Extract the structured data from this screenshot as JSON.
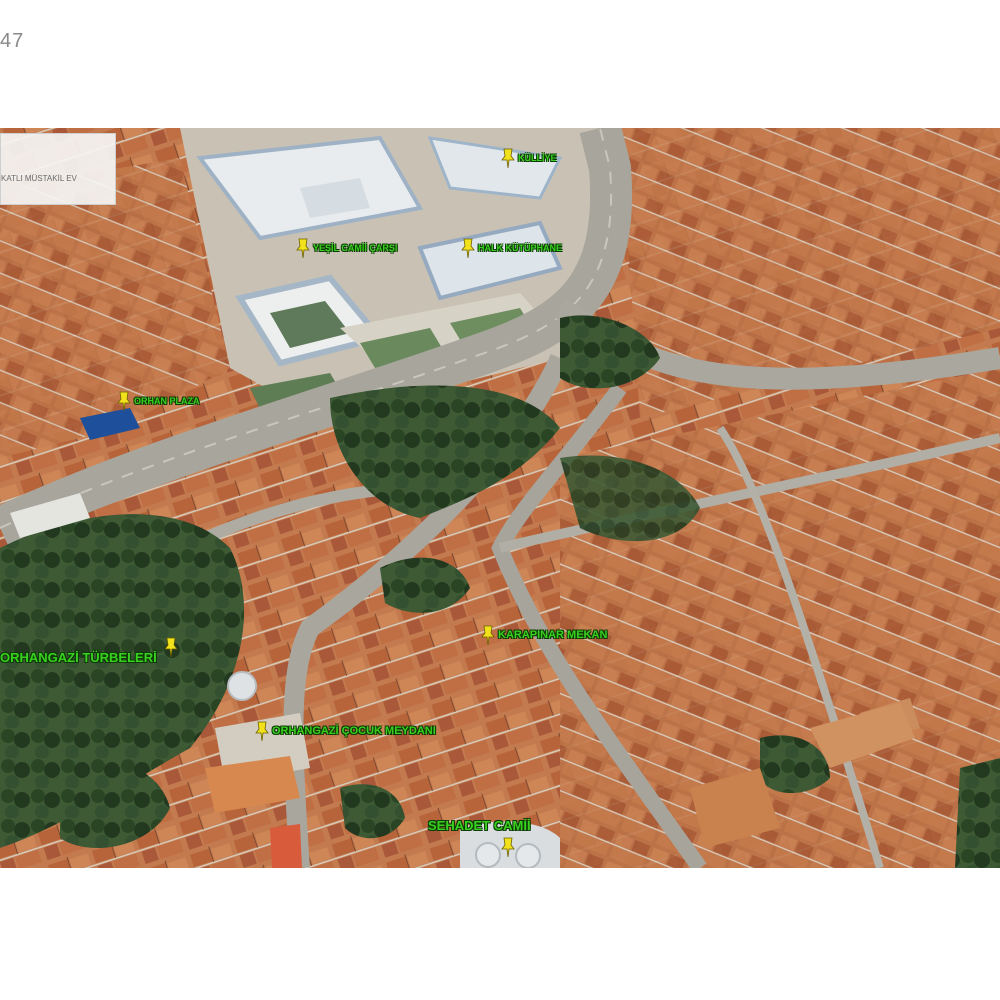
{
  "page_number": "47",
  "info_box": {
    "label": "KATLI MÜSTAKİL EV"
  },
  "map": {
    "type": "3D satellite aerial view",
    "colors": {
      "roof": "#b8693c",
      "tree": "#2c4a26",
      "road": "#a6a49c",
      "label": "#39d11f",
      "pin": "#f2e21c",
      "pool": "#1d4f9a"
    },
    "pois": [
      {
        "name": "KÜLLİYE"
      },
      {
        "name": "YEŞİL CAMİİ ÇARŞI"
      },
      {
        "name": "HALK KÜTÜPHANE"
      },
      {
        "name": "ORHAN PLAZA"
      },
      {
        "name": "ORHANGAZİ TÜRBELERİ"
      },
      {
        "name": "ORHANGAZİ ÇOCUK MEYDANI"
      },
      {
        "name": "KARAPINAR MEKAN"
      },
      {
        "name": "SEHADET CAMİİ"
      }
    ]
  }
}
